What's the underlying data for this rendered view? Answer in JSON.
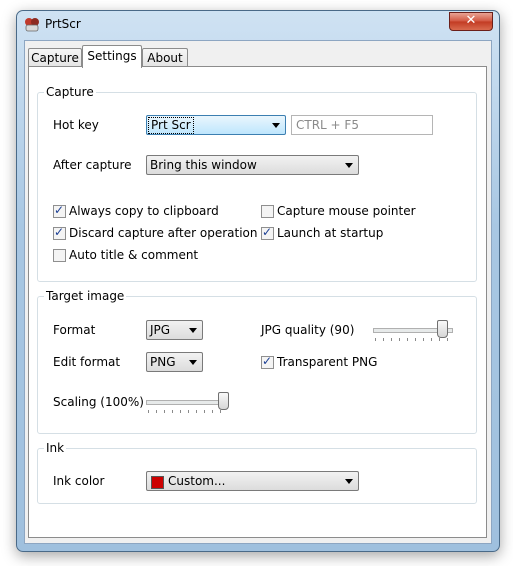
{
  "window": {
    "title": "PrtScr",
    "close_glyph": "✕"
  },
  "tabs": [
    "Capture",
    "Settings",
    "About"
  ],
  "capture_group": {
    "label": "Capture",
    "hotkey_label": "Hot key",
    "hotkey_value": "Prt Scr",
    "hotkey_text": "CTRL + F5",
    "after_label": "After capture",
    "after_value": "Bring this window",
    "checkboxes": [
      {
        "label": "Always copy to clipboard",
        "checked": true
      },
      {
        "label": "Capture mouse pointer",
        "checked": false
      },
      {
        "label": "Discard capture after operation",
        "checked": true
      },
      {
        "label": "Launch at startup",
        "checked": true
      },
      {
        "label": "Auto title & comment",
        "checked": false
      }
    ]
  },
  "target_group": {
    "label": "Target image",
    "format_label": "Format",
    "format_value": "JPG",
    "edit_format_label": "Edit format",
    "edit_format_value": "PNG",
    "jpg_quality_label": "JPG quality (90)",
    "jpg_quality": 90,
    "transparent_label": "Transparent PNG",
    "transparent_checked": true,
    "scaling_label": "Scaling (100%)",
    "scaling": 100
  },
  "ink_group": {
    "label": "Ink",
    "color_label": "Ink color",
    "color_value": "Custom...",
    "color_swatch": "#cc0000"
  }
}
